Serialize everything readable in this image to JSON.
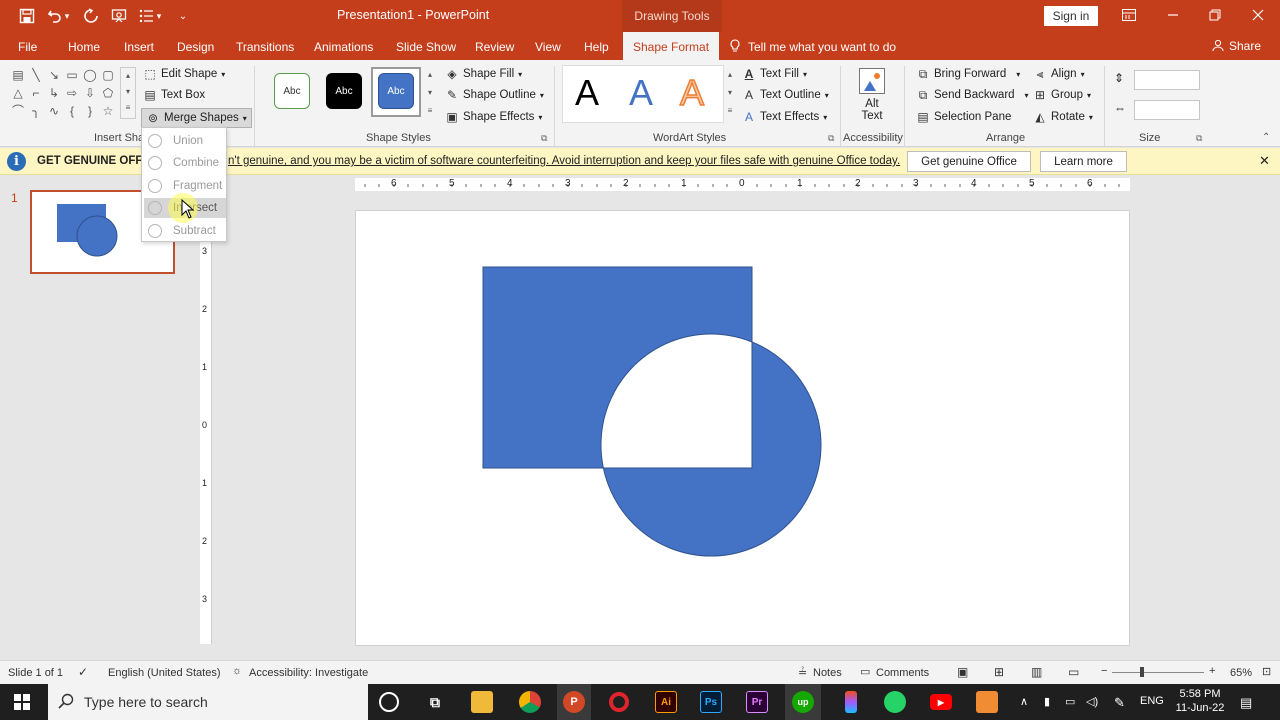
{
  "title_bar": {
    "doc_title": "Presentation1 - PowerPoint",
    "context_title": "Drawing Tools",
    "sign_in": "Sign in",
    "icons": [
      "save-icon",
      "undo-icon",
      "undo-dropdown-icon",
      "redo-icon",
      "present-icon",
      "bullets-icon",
      "customize-qat-icon"
    ],
    "window_buttons": [
      "ribbon-display-icon",
      "minimize-icon",
      "restore-icon",
      "close-icon"
    ]
  },
  "tabs": [
    "File",
    "Home",
    "Insert",
    "Design",
    "Transitions",
    "Animations",
    "Slide Show",
    "Review",
    "View",
    "Help",
    "Shape Format"
  ],
  "active_tab": "Shape Format",
  "tell_me": "Tell me what you want to do",
  "share": "Share",
  "ribbon": {
    "insert_shapes": {
      "label": "Insert Sha",
      "edit_shape": "Edit Shape",
      "text_box": "Text Box",
      "merge_shapes": "Merge Shapes"
    },
    "shape_styles": {
      "label": "Shape Styles",
      "boxes": [
        "Abc",
        "Abc",
        "Abc"
      ],
      "fill": "Shape Fill",
      "outline": "Shape Outline",
      "effects": "Shape Effects"
    },
    "wordart": {
      "label": "WordArt Styles",
      "letters": [
        "A",
        "A",
        "A"
      ],
      "fill": "Text Fill",
      "outline": "Text Outline",
      "effects": "Text Effects"
    },
    "accessibility": {
      "label": "Accessibility",
      "alt_line1": "Alt",
      "alt_line2": "Text"
    },
    "arrange": {
      "label": "Arrange",
      "bring_forward": "Bring Forward",
      "send_backward": "Send Backward",
      "selection_pane": "Selection Pane",
      "align": "Align",
      "group": "Group",
      "rotate": "Rotate"
    },
    "size": {
      "label": "Size",
      "height": "",
      "width": ""
    }
  },
  "message_bar": {
    "bold": "GET GENUINE OFFIC",
    "text": "n't genuine, and you may be a victim of software counterfeiting. Avoid interruption and keep your files safe with genuine Office today.",
    "btn1": "Get genuine Office",
    "btn2": "Learn more"
  },
  "merge_menu": [
    "Union",
    "Combine",
    "Fragment",
    "Intersect",
    "Subtract"
  ],
  "merge_menu_hover": "Intersect",
  "slide_panel": {
    "number": "1"
  },
  "ruler": {
    "h_ticks": [
      "6",
      "5",
      "4",
      "3",
      "2",
      "1",
      "0",
      "1",
      "2",
      "3",
      "4",
      "5",
      "6"
    ],
    "v_ticks": [
      "3",
      "2",
      "1",
      "0",
      "1",
      "2",
      "3"
    ]
  },
  "colors": {
    "accent": "#c43e1c",
    "shape_fill": "#4472c4",
    "shape_stroke": "#2f528f"
  },
  "status_bar": {
    "slide": "Slide 1 of 1",
    "language": "English (United States)",
    "accessibility": "Accessibility: Investigate",
    "notes": "Notes",
    "comments": "Comments",
    "zoom": "65%"
  },
  "taskbar": {
    "search_placeholder": "Type here to search",
    "apps": [
      "Ai",
      "Ps",
      "Pr",
      "up"
    ],
    "lang": "ENG",
    "time": "5:58 PM",
    "date": "11-Jun-22"
  }
}
